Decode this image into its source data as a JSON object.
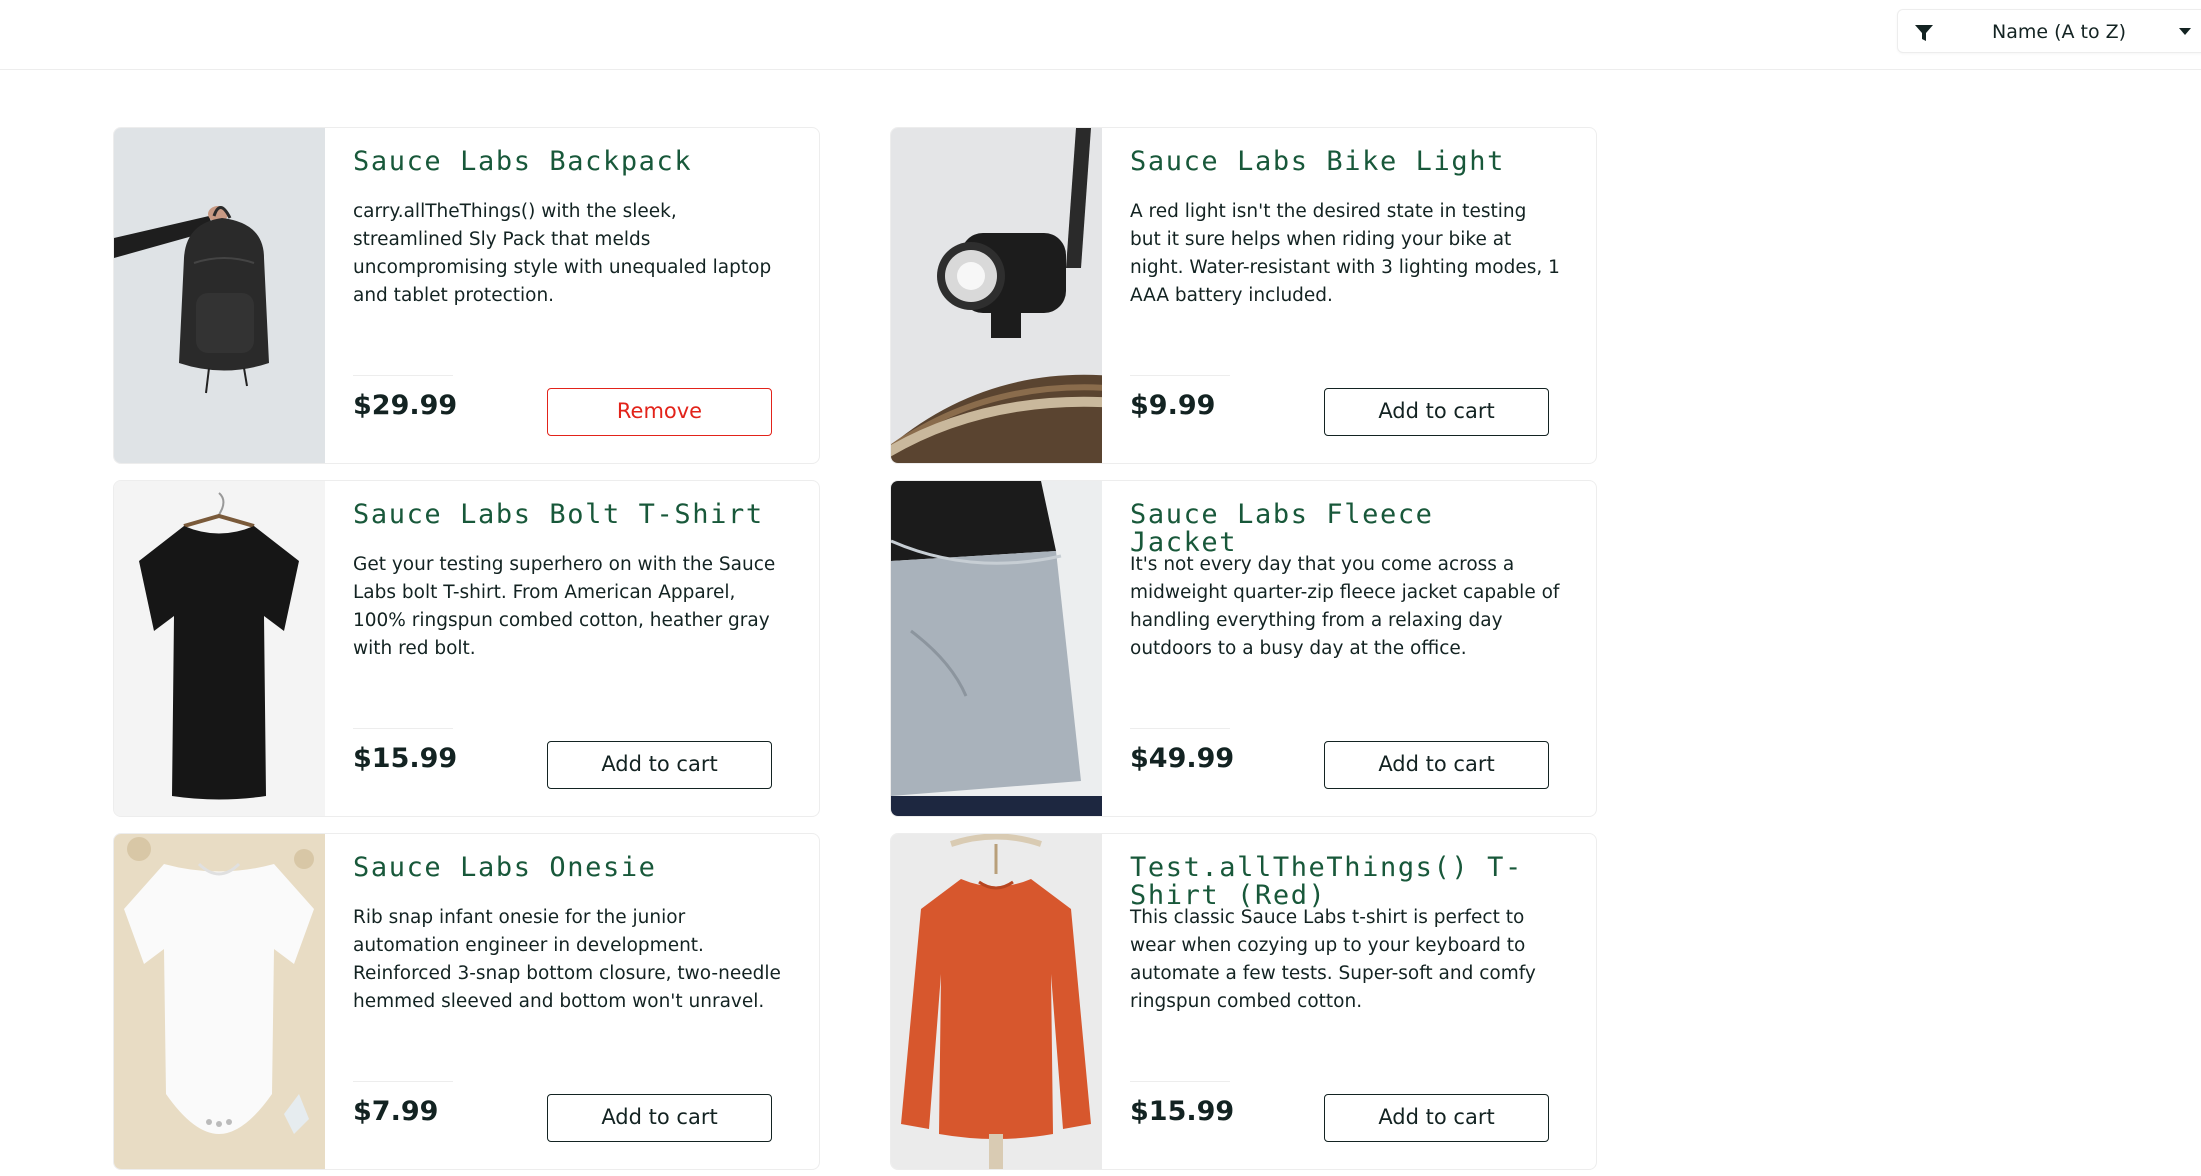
{
  "header": {
    "sort": {
      "selected": "Name (A to Z)",
      "icon": "filter-icon",
      "caret_icon": "chevron-down-icon"
    }
  },
  "colors": {
    "title_green": "#18583a",
    "text_dark": "#132322",
    "remove_red": "#e2231a",
    "border": "#ededed"
  },
  "products": [
    {
      "name": "Sauce Labs Backpack",
      "description": "carry.allTheThings() with the sleek, streamlined Sly Pack that melds uncompromising style with unequaled laptop and tablet protection.",
      "price": "$29.99",
      "button": "Remove",
      "button_state": "remove",
      "image": "backpack-image"
    },
    {
      "name": "Sauce Labs Bike Light",
      "description": "A red light isn't the desired state in testing but it sure helps when riding your bike at night. Water-resistant with 3 lighting modes, 1 AAA battery included.",
      "price": "$9.99",
      "button": "Add to cart",
      "button_state": "add",
      "image": "bike-light-image"
    },
    {
      "name": "Sauce Labs Bolt T-Shirt",
      "description": "Get your testing superhero on with the Sauce Labs bolt T-shirt. From American Apparel, 100% ringspun combed cotton, heather gray with red bolt.",
      "price": "$15.99",
      "button": "Add to cart",
      "button_state": "add",
      "image": "t-shirt-image"
    },
    {
      "name": "Sauce Labs Fleece Jacket",
      "description": "It's not every day that you come across a midweight quarter-zip fleece jacket capable of handling everything from a relaxing day outdoors to a busy day at the office.",
      "price": "$49.99",
      "button": "Add to cart",
      "button_state": "add",
      "image": "fleece-jacket-image"
    },
    {
      "name": "Sauce Labs Onesie",
      "description": "Rib snap infant onesie for the junior automation engineer in development. Reinforced 3-snap bottom closure, two-needle hemmed sleeved and bottom won't unravel.",
      "price": "$7.99",
      "button": "Add to cart",
      "button_state": "add",
      "image": "onesie-image"
    },
    {
      "name": "Test.allTheThings() T-Shirt (Red)",
      "description": "This classic Sauce Labs t-shirt is perfect to wear when cozying up to your keyboard to automate a few tests. Super-soft and comfy ringspun combed cotton.",
      "price": "$15.99",
      "button": "Add to cart",
      "button_state": "add",
      "image": "red-sweatshirt-image"
    }
  ]
}
